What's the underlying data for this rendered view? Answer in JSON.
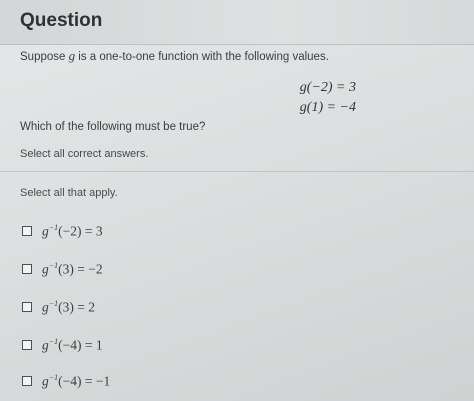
{
  "header": {
    "title": "Question"
  },
  "question": {
    "prompt_before": "Suppose ",
    "prompt_var": "g",
    "prompt_after": " is a one-to-one function with the following values.",
    "given": [
      "g(−2) = 3",
      "g(1) = −4"
    ],
    "which": "Which of the following must be true?",
    "select_correct": "Select all correct answers."
  },
  "answers": {
    "instruction": "Select all that apply.",
    "options": [
      {
        "func": "g",
        "sup": "−1",
        "arg": "(−2) = 3"
      },
      {
        "func": "g",
        "sup": "−1",
        "arg": "(3) = −2"
      },
      {
        "func": "g",
        "sup": "−1",
        "arg": "(3) = 2"
      },
      {
        "func": "g",
        "sup": "−1",
        "arg": "(−4) = 1"
      },
      {
        "func": "g",
        "sup": "−1",
        "arg": "(−4) = −1"
      }
    ]
  }
}
